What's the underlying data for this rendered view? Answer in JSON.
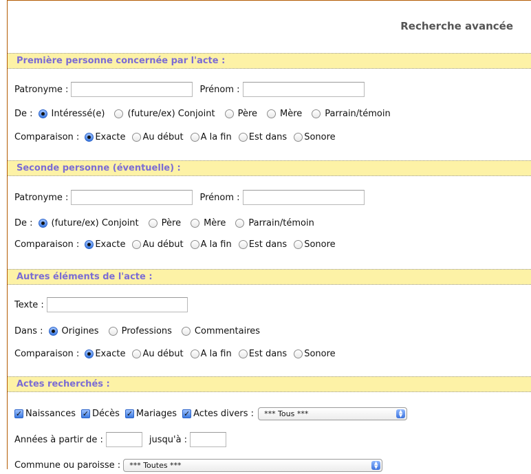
{
  "page": {
    "title": "Recherche avancée"
  },
  "sections": {
    "first": "Première personne concernée par l'acte :",
    "second": "Seconde personne (éventuelle) :",
    "other": "Autres éléments de l'acte :",
    "acts": "Actes recherchés :"
  },
  "labels": {
    "patronyme": "Patronyme :",
    "prenom": "Prénom :",
    "de": "De :",
    "comparaison": "Comparaison :",
    "texte": "Texte :",
    "dans": "Dans :",
    "annees_from": "Années à partir de :",
    "annees_to": "jusqu'à :",
    "commune": "Commune ou paroisse :"
  },
  "first_person": {
    "de_options": [
      "Intéressé(e)",
      "(future/ex) Conjoint",
      "Père",
      "Mère",
      "Parrain/témoin"
    ],
    "de_selected": 0
  },
  "second_person": {
    "de_options": [
      "(future/ex) Conjoint",
      "Père",
      "Mère",
      "Parrain/témoin"
    ],
    "de_selected": 0
  },
  "comparison_options": [
    "Exacte",
    "Au début",
    "A la fin",
    "Est dans",
    "Sonore"
  ],
  "comparison_selected": 0,
  "other": {
    "dans_options": [
      "Origines",
      "Professions",
      "Commentaires"
    ],
    "dans_selected": 0
  },
  "acts": {
    "types": [
      "Naissances",
      "Décès",
      "Mariages",
      "Actes divers :"
    ],
    "checked": [
      true,
      true,
      true,
      true
    ],
    "divers_select": "*** Tous ***",
    "commune_select": "*** Toutes ***"
  },
  "colors": {
    "section_bg": "#fdf2a6",
    "section_text": "#7b6cd4",
    "frame_border": "#b35a00"
  }
}
